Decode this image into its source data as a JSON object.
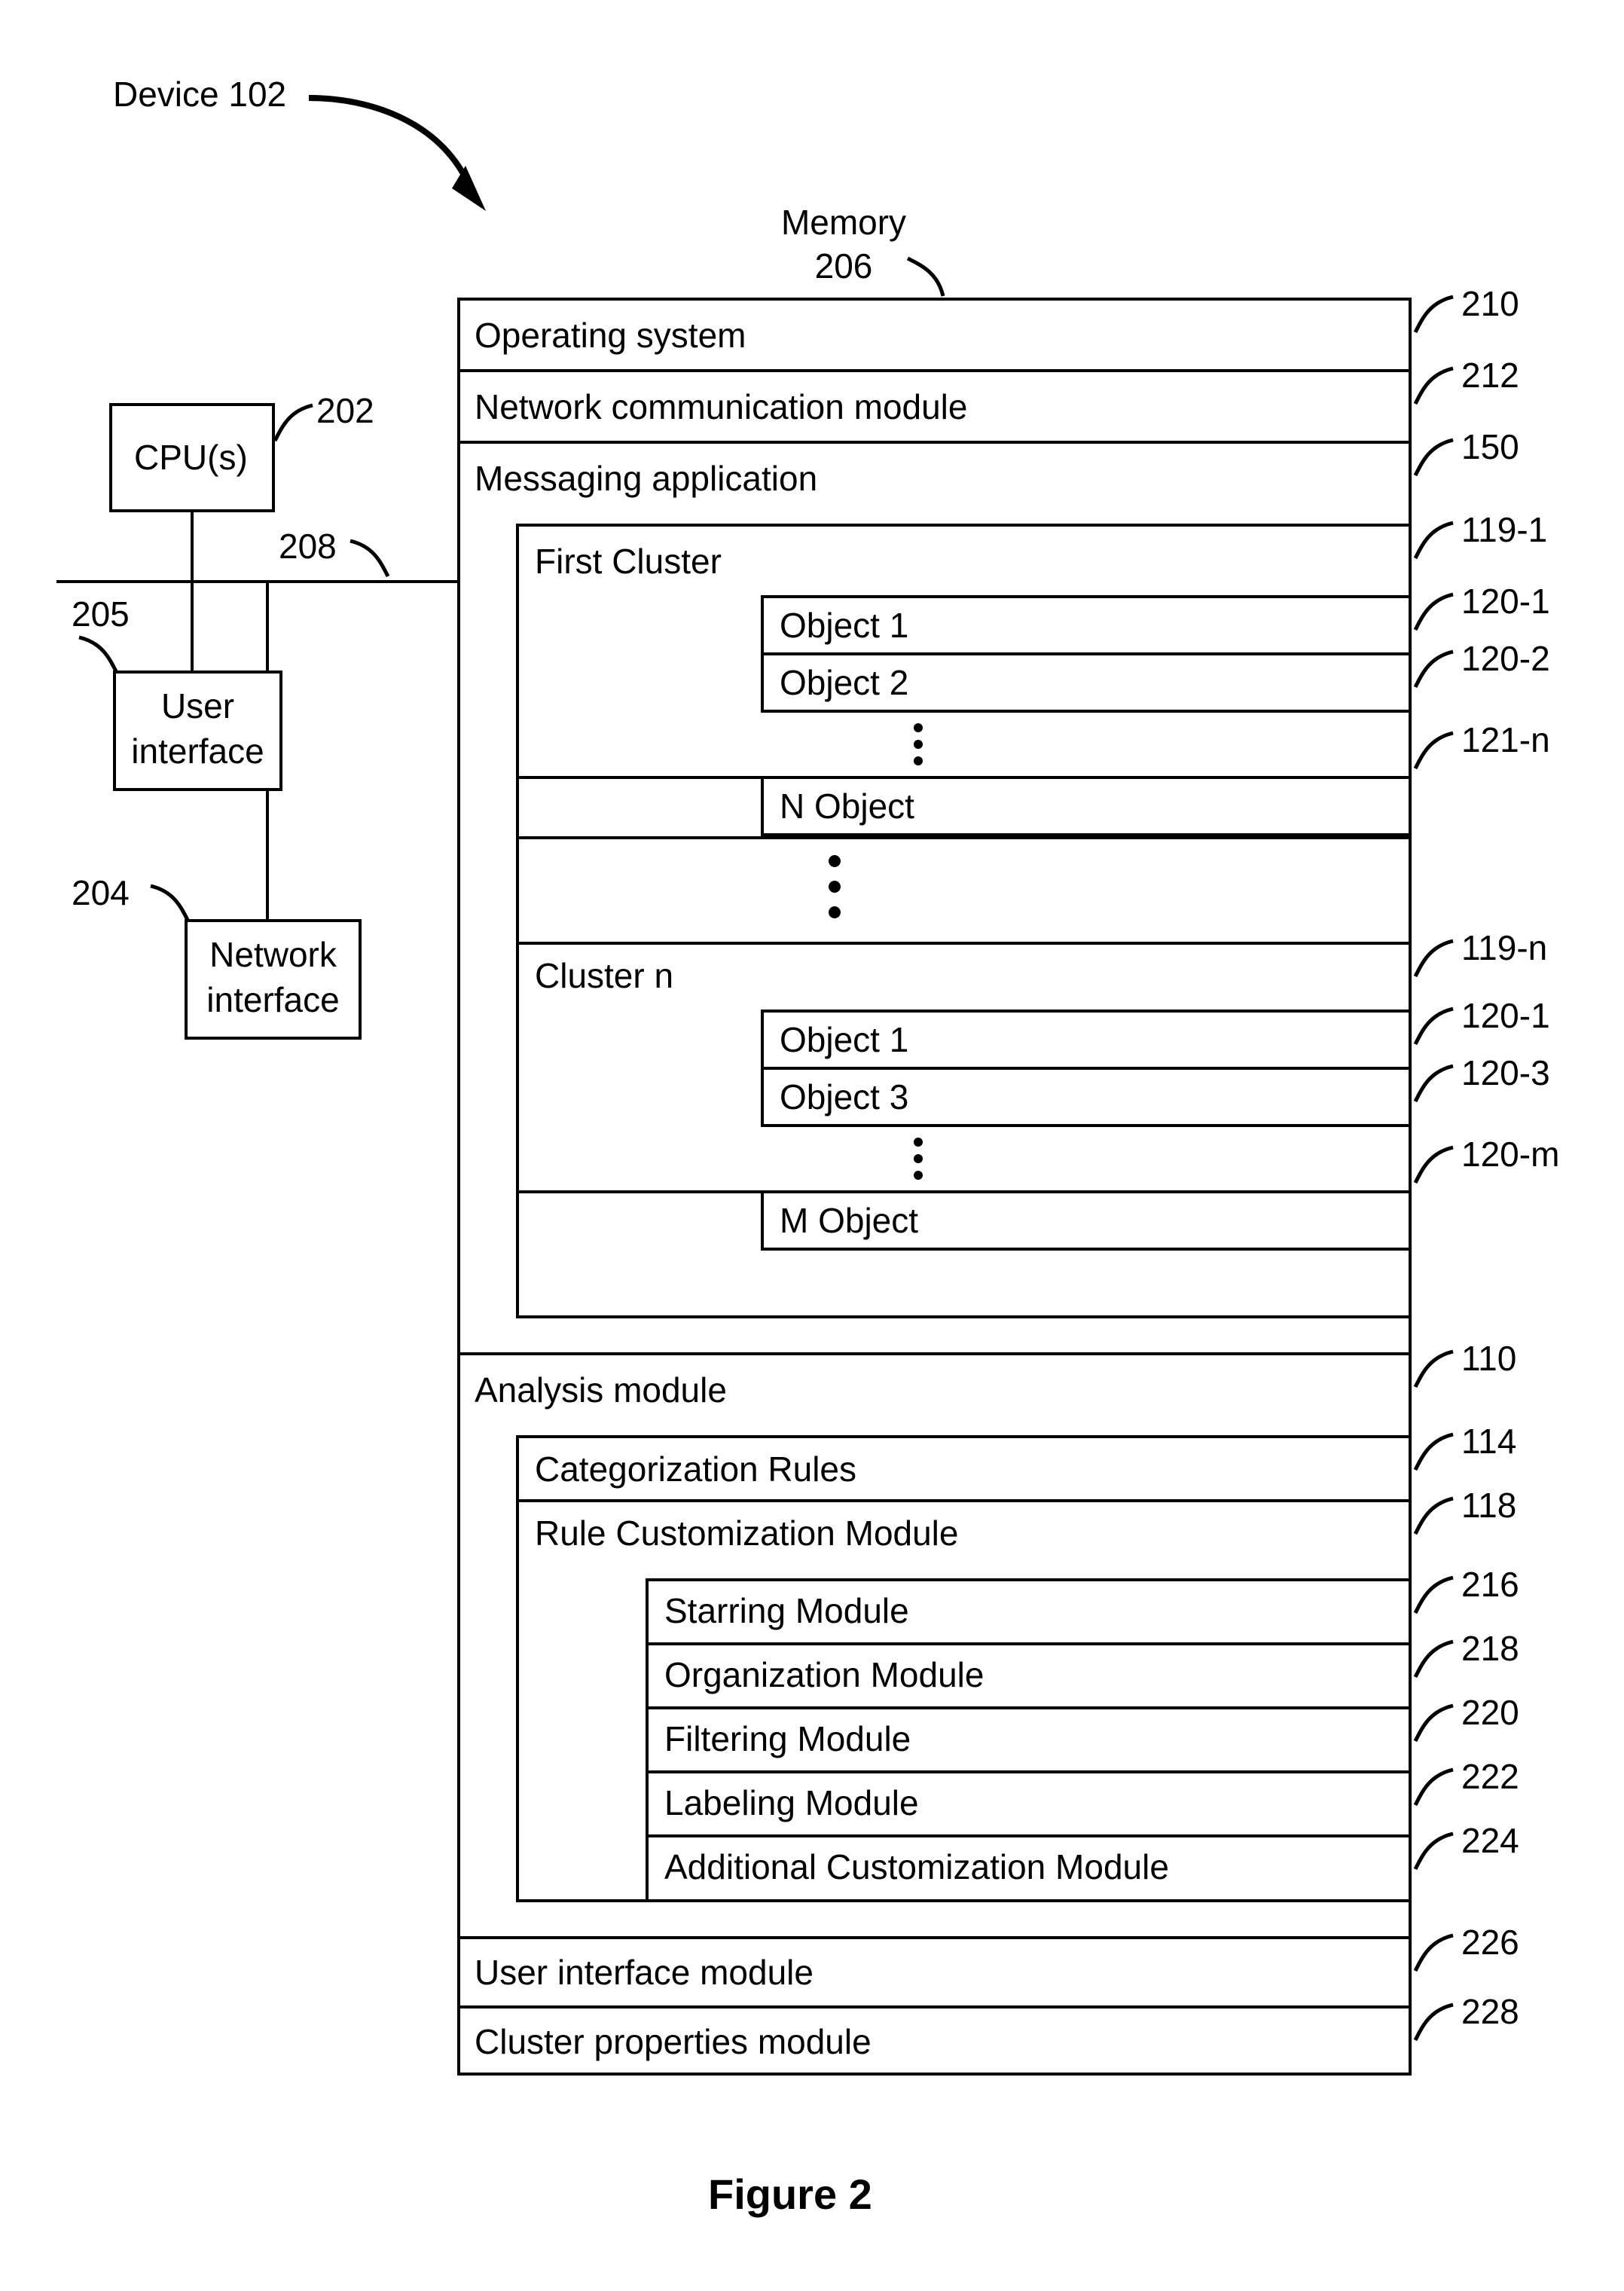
{
  "device_label": "Device 102",
  "cpu": {
    "label": "CPU(s)",
    "ref": "202"
  },
  "bus_ref": "208",
  "user_interface_box": {
    "label1": "User",
    "label2": "interface",
    "ref": "205"
  },
  "network_interface_box": {
    "label1": "Network",
    "label2": "interface",
    "ref": "204"
  },
  "memory": {
    "label": "Memory",
    "ref": "206"
  },
  "rows": {
    "os": {
      "label": "Operating system",
      "ref": "210"
    },
    "net": {
      "label": "Network communication module",
      "ref": "212"
    },
    "msg": {
      "label": "Messaging application",
      "ref": "150"
    },
    "fc": {
      "label": "First Cluster",
      "ref": "119-1"
    },
    "o1": {
      "label": "Object 1",
      "ref": "120-1"
    },
    "o2": {
      "label": "Object 2",
      "ref": "120-2"
    },
    "no": {
      "label": "N Object",
      "ref": "121-n"
    },
    "cn": {
      "label": "Cluster n",
      "ref": "119-n"
    },
    "co1": {
      "label": "Object 1",
      "ref": "120-1"
    },
    "co3": {
      "label": "Object 3",
      "ref": "120-3"
    },
    "mo": {
      "label": "M Object",
      "ref": "120-m"
    },
    "am": {
      "label": "Analysis module",
      "ref": "110"
    },
    "cr": {
      "label": "Categorization Rules",
      "ref": "114"
    },
    "rcm": {
      "label": "Rule Customization Module",
      "ref": "118"
    },
    "sm": {
      "label": "Starring Module",
      "ref": "216"
    },
    "om": {
      "label": "Organization Module",
      "ref": "218"
    },
    "fm": {
      "label": "Filtering Module",
      "ref": "220"
    },
    "lm": {
      "label": "Labeling Module",
      "ref": "222"
    },
    "acm": {
      "label": "Additional Customization Module",
      "ref": "224"
    },
    "uim": {
      "label": "User interface module",
      "ref": "226"
    },
    "cpm": {
      "label": "Cluster properties module",
      "ref": "228"
    }
  },
  "figure_caption": "Figure 2"
}
